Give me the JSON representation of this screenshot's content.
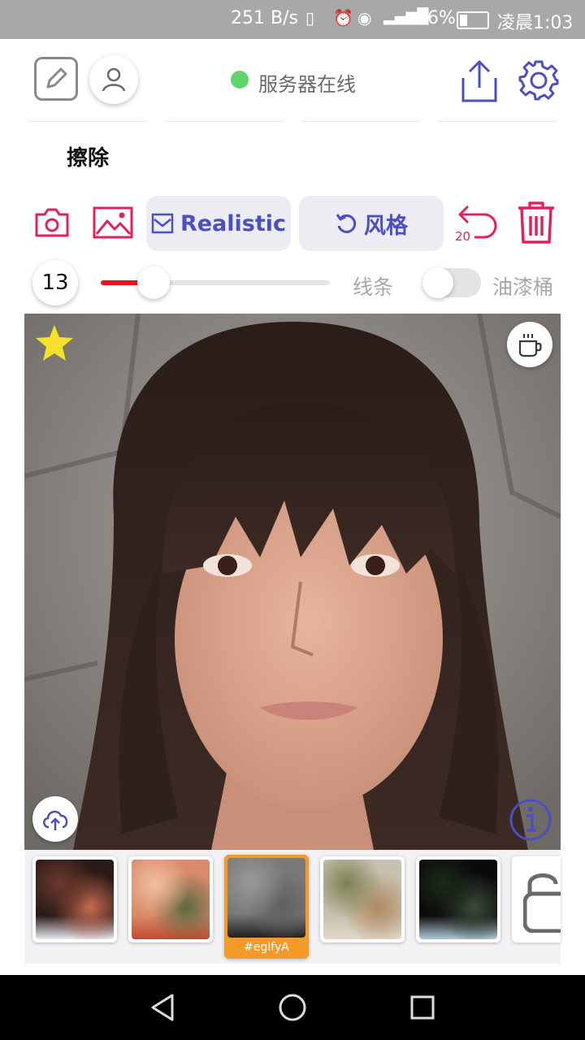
{
  "status_bar": {
    "network_speed": "251 B/s",
    "battery": "26%",
    "time": "凌晨1:03"
  },
  "header": {
    "server_status": "服务器在线",
    "status_color": "#5ed56a",
    "mode_title": "擦除"
  },
  "toolbar": {
    "realistic_label": "Realistic",
    "style_label": "风格",
    "undo_count": "20",
    "accent_color": "#e0225e",
    "brand_color": "#4b4fc4"
  },
  "brush": {
    "size": "13",
    "slider_fraction": 0.23,
    "line_label": "线条",
    "bucket_label": "油漆桶",
    "bucket_enabled": false
  },
  "canvas": {
    "favorite": true
  },
  "thumbnails": [
    {
      "id": "thumb-1",
      "palette": [
        "#2a1a18",
        "#6b3a2a",
        "#c86a50",
        "#e8e8f0"
      ],
      "selected": false
    },
    {
      "id": "thumb-2",
      "palette": [
        "#d98a6a",
        "#f0c0a0",
        "#5a6a40",
        "#c04a30"
      ],
      "selected": false
    },
    {
      "id": "thumb-3",
      "palette": [
        "#7a7878",
        "#9a9898",
        "#606060",
        "#202020"
      ],
      "selected": true,
      "label": "#eglfyA"
    },
    {
      "id": "thumb-4",
      "palette": [
        "#c8c0b0",
        "#7a8050",
        "#b08a60",
        "#e0d8c8"
      ],
      "selected": false
    },
    {
      "id": "thumb-5",
      "palette": [
        "#0a0a0a",
        "#1a2a18",
        "#3a4a38",
        "#b0c8d8"
      ],
      "selected": false
    }
  ]
}
